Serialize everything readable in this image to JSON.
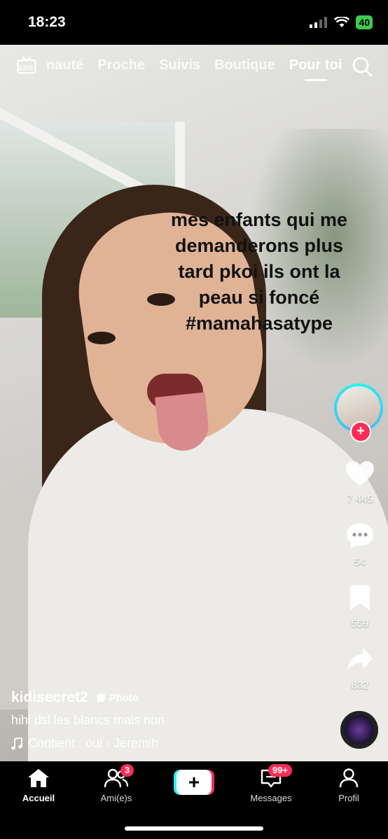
{
  "status_bar": {
    "time": "18:23",
    "battery": "40"
  },
  "top_nav": {
    "live_label": "LIVE",
    "tabs": [
      {
        "label": "nauté"
      },
      {
        "label": "Proche"
      },
      {
        "label": "Suivis"
      },
      {
        "label": "Boutique"
      },
      {
        "label": "Pour toi"
      }
    ],
    "active_tab": "Pour toi"
  },
  "video": {
    "caption_lines": [
      "mes enfants qui me",
      "demanderons plus",
      "tard pkoi ils ont la",
      "peau si foncé",
      "#mamahasatype"
    ]
  },
  "actions": {
    "likes": "7 445",
    "comments": "54",
    "saves": "559",
    "shares": "832",
    "follow_symbol": "+"
  },
  "post": {
    "username": "kidisecret2",
    "type_badge": "Photo",
    "description": "hihi dsl les blancs mais non",
    "music": "Contient : oui - Jeremih"
  },
  "bottom_nav": {
    "home": "Accueil",
    "friends": "Ami(e)s",
    "friends_badge": "3",
    "create": "+",
    "inbox": "Messages",
    "inbox_badge": "99+",
    "profile": "Profil"
  },
  "colors": {
    "accent": "#fe2c55",
    "cyan": "#25f4ee",
    "battery": "#3ecb4f"
  }
}
